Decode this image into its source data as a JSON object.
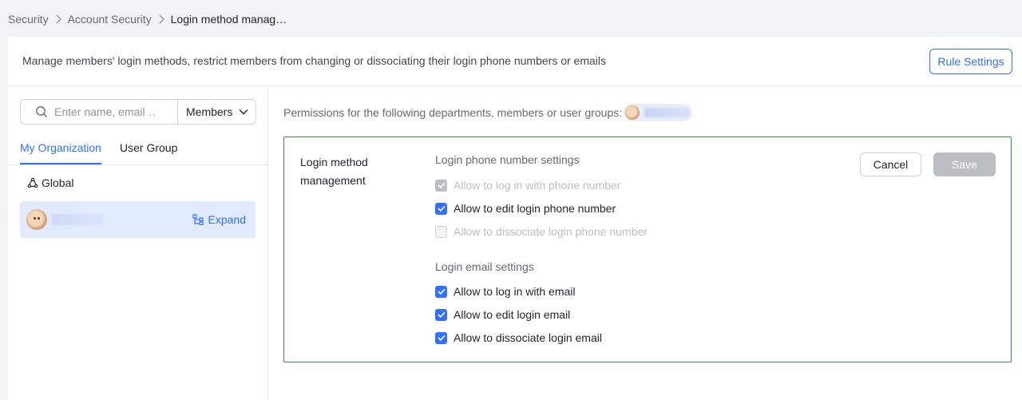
{
  "breadcrumb": {
    "items": [
      "Security",
      "Account Security",
      "Login method manag…"
    ]
  },
  "header": {
    "description": "Manage members' login methods, restrict members from changing or dissociating their login phone numbers or emails",
    "rule_settings_label": "Rule Settings"
  },
  "sidebar": {
    "search_placeholder": "Enter name, email …",
    "filter_label": "Members",
    "tabs": [
      {
        "label": "My Organization",
        "active": true
      },
      {
        "label": "User Group",
        "active": false
      }
    ],
    "global_label": "Global",
    "member": {
      "expand_label": "Expand"
    }
  },
  "main": {
    "permissions_label": "Permissions for the following departments, members or user groups:",
    "card": {
      "title": "Login method management",
      "phone_section": {
        "title": "Login phone number settings",
        "options": [
          {
            "label": "Allow to log in with phone number",
            "checked": true,
            "disabled": true
          },
          {
            "label": "Allow to edit login phone number",
            "checked": true,
            "disabled": false
          },
          {
            "label": "Allow to dissociate login phone number",
            "checked": false,
            "disabled": true
          }
        ]
      },
      "email_section": {
        "title": "Login email settings",
        "options": [
          {
            "label": "Allow to log in with email",
            "checked": true,
            "disabled": false
          },
          {
            "label": "Allow to edit login email",
            "checked": true,
            "disabled": false
          },
          {
            "label": "Allow to dissociate login email",
            "checked": true,
            "disabled": false
          }
        ]
      },
      "cancel_label": "Cancel",
      "save_label": "Save"
    }
  },
  "colors": {
    "accent": "#3370ff",
    "selected_row": "#e1eaff",
    "disabled": "#bbbfc4"
  }
}
